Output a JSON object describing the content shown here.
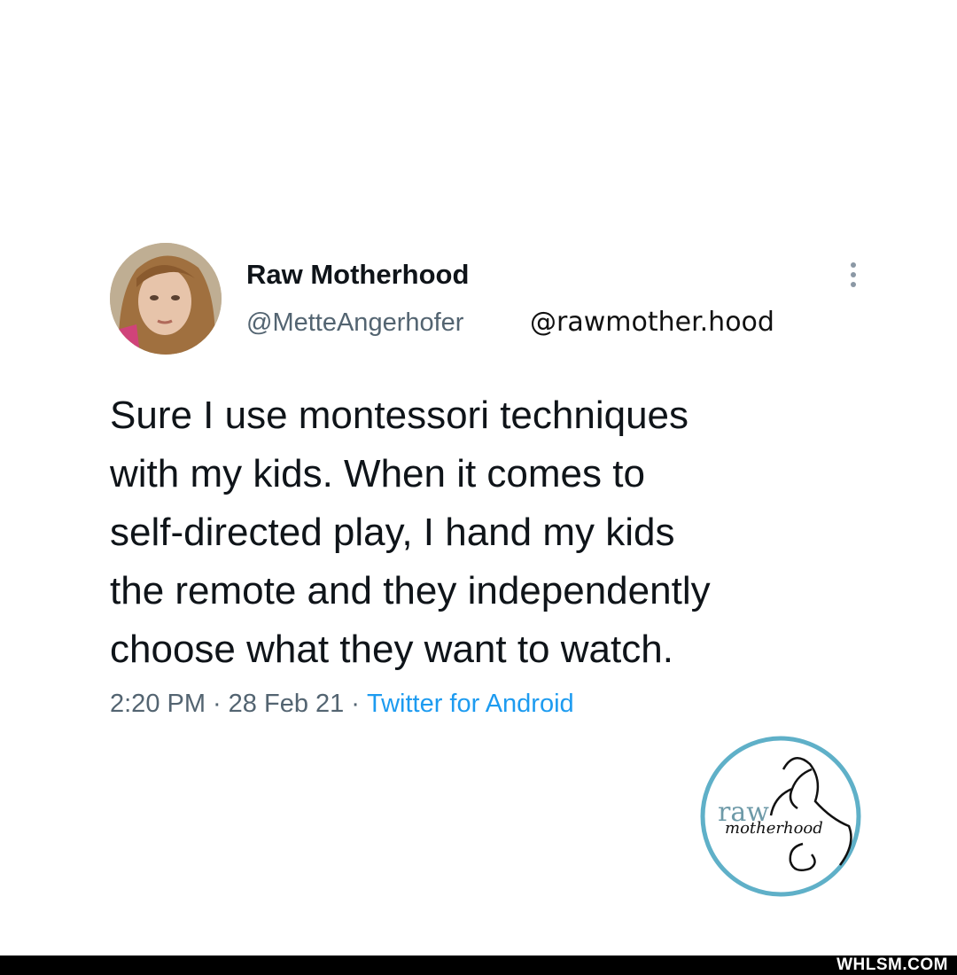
{
  "tweet": {
    "display_name": "Raw Motherhood",
    "handle": "@MetteAngerhofer",
    "text_lines": [
      "Sure I use montessori techniques",
      "with my kids. When it comes to",
      "self-directed play, I hand my kids",
      "the remote and they independently",
      "choose what they want to watch."
    ],
    "time": "2:20 PM",
    "date": "28 Feb 21",
    "source": "Twitter for Android",
    "separator": "·",
    "more_icon": "more-vertical-icon"
  },
  "overlay": {
    "instagram_handle": "@rawmother.hood",
    "logo_text": "raw motherhood"
  },
  "footer": {
    "site": "WHLSM.COM"
  },
  "colors": {
    "name": "#0f1419",
    "secondary": "#536471",
    "link": "#1d9bf0",
    "logo_ring": "#5fb0c8"
  }
}
